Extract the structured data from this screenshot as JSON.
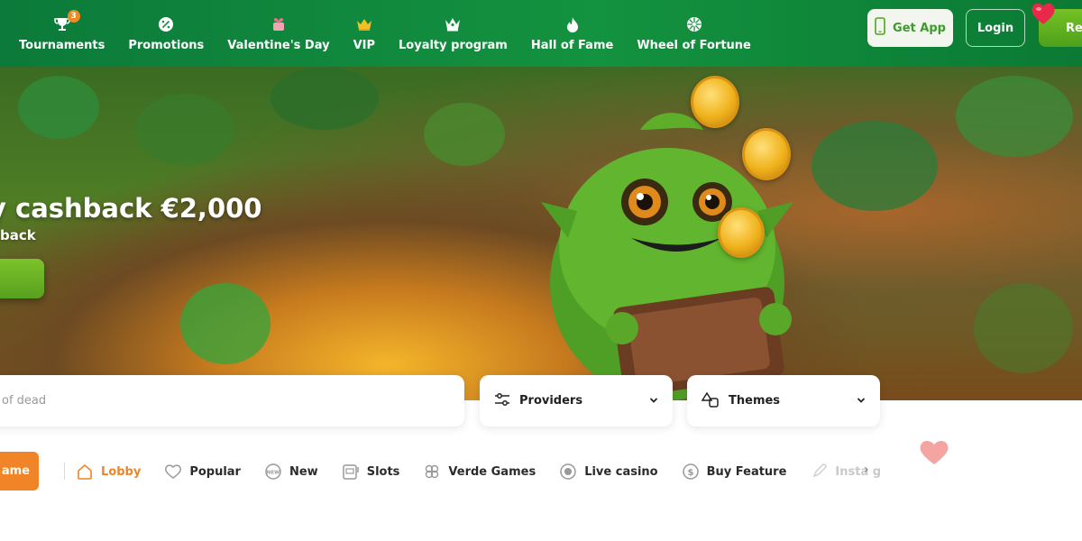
{
  "nav": {
    "items": [
      {
        "label": "Tournaments",
        "icon": "trophy-icon",
        "badge": "3"
      },
      {
        "label": "Promotions",
        "icon": "percent-badge-icon"
      },
      {
        "label": "Valentine's Day",
        "icon": "gift-heart-icon"
      },
      {
        "label": "VIP",
        "icon": "crown-icon"
      },
      {
        "label": "Loyalty program",
        "icon": "queen-crown-icon"
      },
      {
        "label": "Hall of Fame",
        "icon": "flame-icon"
      },
      {
        "label": "Wheel of Fortune",
        "icon": "wheel-icon"
      }
    ]
  },
  "header": {
    "get_app": "Get App",
    "login": "Login",
    "register": "Reg"
  },
  "hero": {
    "title": "y cashback €2,000",
    "subtitle": "back"
  },
  "search": {
    "placeholder": "of dead"
  },
  "filters": {
    "providers": "Providers",
    "themes": "Themes"
  },
  "categories": {
    "play_button": "ame",
    "items": [
      {
        "label": "Lobby",
        "icon": "home-icon"
      },
      {
        "label": "Popular",
        "icon": "heart-outline-icon"
      },
      {
        "label": "New",
        "icon": "new-badge-icon"
      },
      {
        "label": "Slots",
        "icon": "slot-machine-icon"
      },
      {
        "label": "Verde Games",
        "icon": "clover-icon"
      },
      {
        "label": "Live casino",
        "icon": "live-dot-icon"
      },
      {
        "label": "Buy Feature",
        "icon": "dollar-coin-icon"
      },
      {
        "label": "Insta g",
        "icon": "rocket-icon"
      }
    ],
    "next_arrow": "›"
  },
  "colors": {
    "brand_green": "#13923f",
    "accent_orange": "#f08426",
    "cta_green": "#5fab1f"
  }
}
